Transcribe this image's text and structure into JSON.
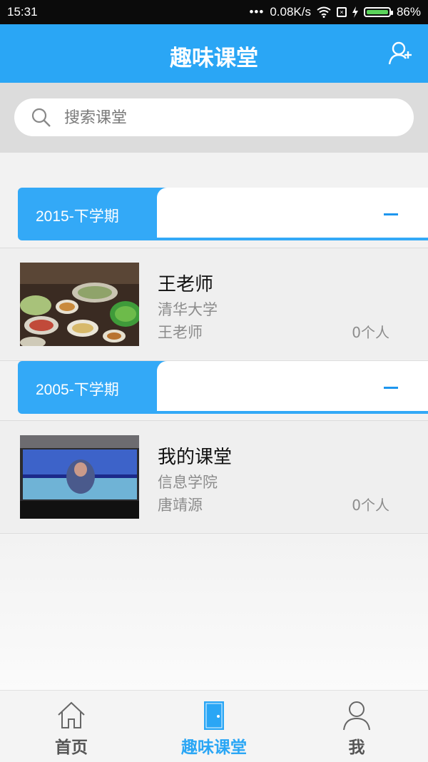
{
  "status_bar": {
    "time": "15:31",
    "network_speed": "0.08K/s",
    "battery": "86%",
    "icons": [
      "dots-icon",
      "wifi-icon",
      "no-sim-icon",
      "charging-icon",
      "battery-icon"
    ]
  },
  "header": {
    "title": "趣味课堂",
    "add_user_icon": "add-user-icon"
  },
  "search": {
    "placeholder": "搜索课堂",
    "icon": "search-icon"
  },
  "semesters": [
    {
      "label": "2015-下学期",
      "collapse_symbol": "—",
      "courses": [
        {
          "name": "王老师",
          "school": "清华大学",
          "teacher": "王老师",
          "count": "0个人",
          "thumbnail": "food-photo"
        }
      ]
    },
    {
      "label": "2005-下学期",
      "collapse_symbol": "—",
      "courses": [
        {
          "name": "我的课堂",
          "school": "信息学院",
          "teacher": "唐靖源",
          "count": "0个人",
          "thumbnail": "laptop-screen-photo"
        }
      ]
    }
  ],
  "tabbar": {
    "tabs": [
      {
        "label": "首页",
        "icon": "home-icon",
        "active": false
      },
      {
        "label": "趣味课堂",
        "icon": "door-icon",
        "active": true
      },
      {
        "label": "我",
        "icon": "user-icon",
        "active": false
      }
    ]
  },
  "colors": {
    "primary": "#2aa6f5",
    "semester_bar": "#33a9f7",
    "status_bar": "#0b0b0b",
    "battery_fill": "#5bd35b"
  }
}
